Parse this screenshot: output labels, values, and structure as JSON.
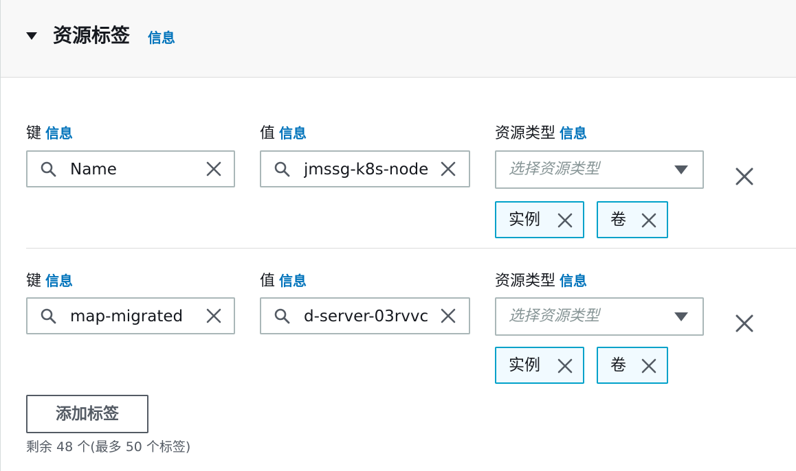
{
  "section": {
    "title": "资源标签",
    "info_link": "信息"
  },
  "fields": {
    "key_label": "键",
    "value_label": "值",
    "resource_type_label": "资源类型",
    "info_link": "信息",
    "resource_type_placeholder": "选择资源类型"
  },
  "tags": [
    {
      "key": "Name",
      "value": "jmssg-k8s-node",
      "resource_types": [
        "实例",
        "卷"
      ]
    },
    {
      "key": "map-migrated",
      "value": "d-server-03rvvc",
      "resource_types": [
        "实例",
        "卷"
      ]
    }
  ],
  "add_tag_button": "添加标签",
  "remaining_text": "剩余 48 个(最多 50 个标签)",
  "colors": {
    "info_link": "#0073bb",
    "token_border": "#00a1c9",
    "token_bg": "#f1faff",
    "input_border": "#aab7b8",
    "header_bg": "#f8f8f8"
  },
  "icons": {
    "expand": "caret-down-icon",
    "search": "search-icon",
    "clear": "close-icon",
    "dropdown": "caret-down-icon",
    "remove": "close-icon"
  }
}
